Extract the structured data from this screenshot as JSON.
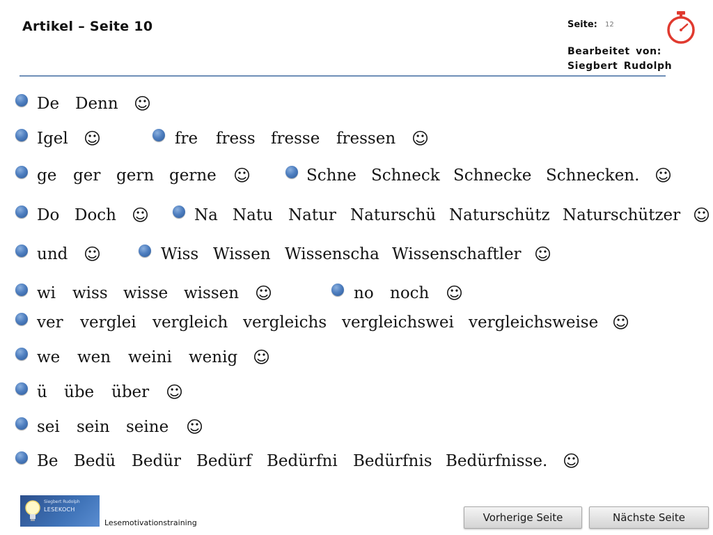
{
  "header": {
    "title": "Artikel – Seite 10",
    "page_label": "Seite:",
    "page_number": "12",
    "edited_by_label": "Bearbeitet von:",
    "edited_by_name": "Siegbert Rudolph",
    "timer_icon": "stopwatch-icon",
    "timer_color": "#e03a2f"
  },
  "smiley_glyph": "☺",
  "rows": [
    {
      "groups": [
        {
          "words": [
            "De",
            "Denn"
          ]
        }
      ]
    },
    {
      "groups": [
        {
          "words": [
            "Igel"
          ]
        },
        {
          "words": [
            "fre",
            "fress",
            "fresse",
            "fressen"
          ]
        }
      ]
    },
    {
      "groups": [
        {
          "words": [
            "ge",
            "ger",
            "gern",
            "gerne"
          ]
        },
        {
          "words": [
            "Schne",
            "Schneck",
            "Schnecke",
            "Schnecken."
          ]
        }
      ]
    },
    {
      "groups": [
        {
          "words": [
            "Do",
            "Doch"
          ]
        },
        {
          "words": [
            "Na",
            "Natu",
            "Natur",
            "Naturschü",
            "Naturschütz",
            "Naturschützer"
          ]
        }
      ]
    },
    {
      "groups": [
        {
          "words": [
            "und"
          ]
        },
        {
          "words": [
            "Wiss",
            "Wissen",
            "Wissenscha",
            "Wissenschaftler"
          ]
        }
      ]
    },
    {
      "groups": [
        {
          "words": [
            "wi",
            "wiss",
            "wisse",
            "wissen"
          ]
        },
        {
          "words": [
            "no",
            "noch"
          ]
        }
      ]
    },
    {
      "groups": [
        {
          "words": [
            "ver",
            "verglei",
            "vergleich",
            "vergleichs",
            "vergleichswei",
            "vergleichsweise"
          ]
        }
      ]
    },
    {
      "groups": [
        {
          "words": [
            "we",
            "wen",
            "weini",
            "wenig"
          ]
        }
      ]
    },
    {
      "groups": [
        {
          "words": [
            "ü",
            "übe",
            "über"
          ]
        }
      ]
    },
    {
      "groups": [
        {
          "words": [
            "sei",
            "sein",
            "seine"
          ]
        }
      ]
    },
    {
      "groups": [
        {
          "words": [
            "Be",
            "Bedü",
            "Bedür",
            "Bedürf",
            "Bedürfni",
            "Bedürfnis",
            "Bedürfnisse."
          ]
        }
      ]
    }
  ],
  "footer": {
    "logo_line1": "Siegbert Rudolph",
    "logo_line2": "LESEKOCH",
    "program_label": "Lesemotivationstraining",
    "prev_button": "Vorherige Seite",
    "next_button": "Nächste Seite"
  },
  "colors": {
    "bullet": "#4f7fc0",
    "rule": "#6f8fb8",
    "logo_bg": "#3f73b8"
  }
}
